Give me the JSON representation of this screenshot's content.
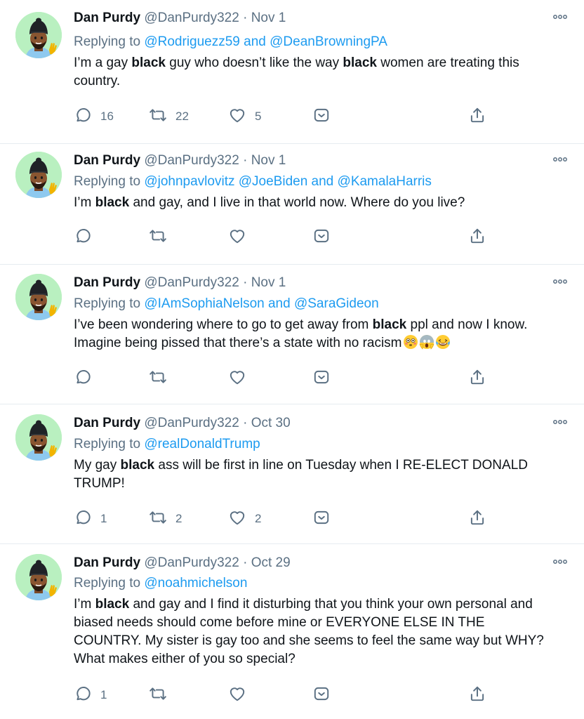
{
  "tweets": [
    {
      "name": "Dan Purdy",
      "handle": "@DanPurdy322",
      "separator": "·",
      "date": "Nov 1",
      "replying_prefix": "Replying to",
      "replying_to": "@Rodriguezz59 and @DeanBrowningPA",
      "text_parts": [
        "I’m a gay ",
        "black",
        " guy who doesn’t like the way ",
        "black",
        " women are treating this country."
      ],
      "reply_count": "16",
      "retweet_count": "22",
      "like_count": "5"
    },
    {
      "name": "Dan Purdy",
      "handle": "@DanPurdy322",
      "separator": "·",
      "date": "Nov 1",
      "replying_prefix": "Replying to",
      "replying_to": "@johnpavlovitz @JoeBiden and @KamalaHarris",
      "text_parts": [
        "I’m ",
        "black",
        " and gay, and I live in that world now. Where do you live?"
      ],
      "reply_count": "",
      "retweet_count": "",
      "like_count": ""
    },
    {
      "name": "Dan Purdy",
      "handle": "@DanPurdy322",
      "separator": "·",
      "date": "Nov 1",
      "replying_prefix": "Replying to",
      "replying_to": "@IAmSophiaNelson and @SaraGideon",
      "text_parts": [
        "I’ve been wondering where to go to get away from ",
        "black",
        " ppl and now I know. Imagine being pissed that there’s a state with no racism"
      ],
      "emojis": [
        "flushed-face",
        "screaming-face",
        "tears-of-joy"
      ],
      "reply_count": "",
      "retweet_count": "",
      "like_count": ""
    },
    {
      "name": "Dan Purdy",
      "handle": "@DanPurdy322",
      "separator": "·",
      "date": "Oct 30",
      "replying_prefix": "Replying to",
      "replying_to": "@realDonaldTrump",
      "text_parts": [
        "My gay ",
        "black",
        " ass will be first in line on Tuesday when I RE-ELECT DONALD TRUMP!"
      ],
      "reply_count": "1",
      "retweet_count": "2",
      "like_count": "2"
    },
    {
      "name": "Dan Purdy",
      "handle": "@DanPurdy322",
      "separator": "·",
      "date": "Oct 29",
      "replying_prefix": "Replying to",
      "replying_to": "@noahmichelson",
      "text_parts": [
        "I’m ",
        "black",
        " and gay and I find it disturbing that you think your own personal and biased needs should come before mine or EVERYONE ELSE IN THE COUNTRY. My sister is gay too and she seems to feel the same way but WHY? What makes either of you so special?"
      ],
      "reply_count": "1",
      "retweet_count": "",
      "like_count": ""
    }
  ],
  "icons": {
    "reply": "reply-icon",
    "retweet": "retweet-icon",
    "like": "heart-icon",
    "tip": "tip-icon",
    "share": "share-icon",
    "more": "more-icon"
  },
  "colors": {
    "link": "#1d9bf0",
    "secondary": "#5b7083",
    "avatar_bg": "#b9f0c0"
  }
}
